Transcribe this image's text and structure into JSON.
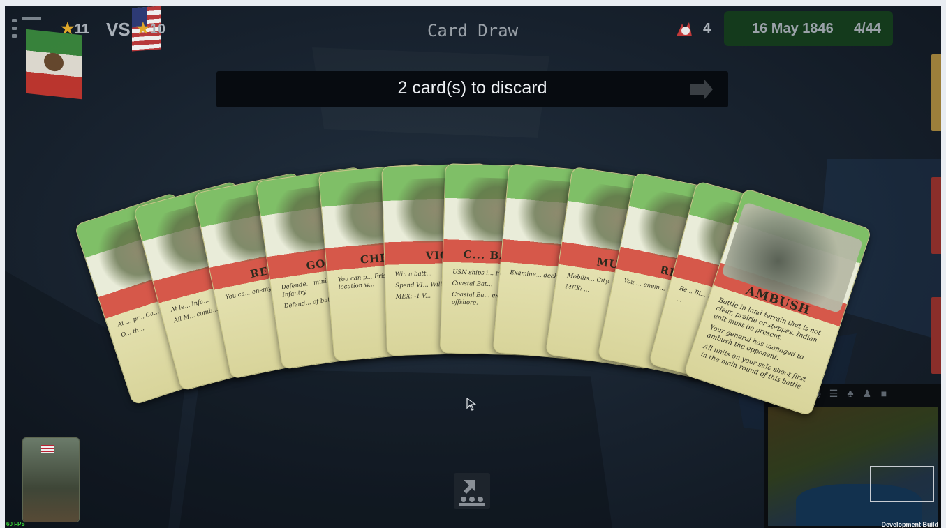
{
  "hud": {
    "menu_icon": "menu-list-icon",
    "mexico_score": "11",
    "vs_label": "VS",
    "usa_score": "10",
    "phase_title": "Card Draw",
    "casualties": "4",
    "date": "16 May 1846",
    "turn": "4/44"
  },
  "banner": {
    "text": "2 card(s) to discard",
    "next_icon": "arrow-right-icon"
  },
  "hand": {
    "cards": [
      {
        "title": "",
        "body": [
          "At ... pr... Ca...",
          "O... th..."
        ]
      },
      {
        "title": "",
        "body": [
          "At le... Infa...",
          "All M... comb... Mex..."
        ]
      },
      {
        "title": "REC",
        "body": [
          "You ca... enemy..."
        ]
      },
      {
        "title": "GOO",
        "body": [
          "Defende... minimu... Infantry",
          "Defend... of batt..."
        ]
      },
      {
        "title": "CHEV",
        "body": [
          "You can p... Frise obs... location w..."
        ]
      },
      {
        "title": "VIC",
        "body": [
          "Win a batt...",
          "Spend VI... Will indez...",
          "MEX: -1 V..."
        ]
      },
      {
        "title": "C... BAT...",
        "body": [
          "USN ships i... Fort San Ju...",
          "Coastal Bat...",
          "Coastal Ba... exchange f... offshore."
        ]
      },
      {
        "title": "",
        "body": [
          "Examine... deck."
        ]
      },
      {
        "title": "MUS",
        "body": [
          "Mobilis... City.",
          "MEX: ..."
        ]
      },
      {
        "title": "RE",
        "body": [
          "You ... enem..."
        ]
      },
      {
        "title": "",
        "body": [
          "Re... Bi... w...",
          "..."
        ]
      },
      {
        "title": "AMBUSH",
        "body": [
          "Battle in land terrain that is not clear, prairie or steppes. Indian unit must be present.",
          "Your general has managed to ambush the opponent.",
          "All units on your side shoot first in the main round of this battle."
        ]
      }
    ]
  },
  "footer": {
    "fps": "60 FPS",
    "build": "Development Build"
  },
  "minimap": {
    "tools": [
      "down-arrow-icon",
      "ring-icon",
      "ring-filled-icon",
      "list-icon",
      "group-icon",
      "unit-icon",
      "square-icon"
    ]
  },
  "colors": {
    "date_panel": "#143a1c",
    "banner_bg": "#070b10",
    "star": "#e0a82a",
    "fps_text": "#3bd43b"
  }
}
